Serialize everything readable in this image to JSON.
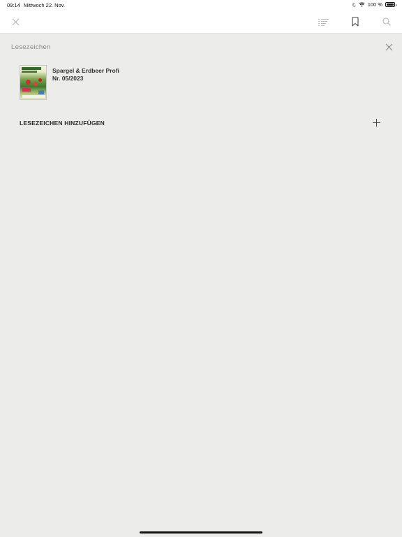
{
  "status_bar": {
    "time": "09:14",
    "date": "Mittwoch 22. Nov.",
    "battery_text": "100 %",
    "battery_level": 1.0
  },
  "toolbar": {
    "icons": [
      "close-icon",
      "list-icon",
      "bookmark-icon",
      "search-icon"
    ]
  },
  "panel": {
    "title": "Lesezeichen",
    "bookmarks": [
      {
        "title": "Spargel & Erdbeer Profi",
        "issue": "Nr. 05/2023"
      }
    ],
    "add_label": "LESEZEICHEN HINZUFÜGEN"
  },
  "colors": {
    "background": "#ececea",
    "toolbar": "#ffffff",
    "icon_muted": "#b5b5b5",
    "text_muted": "#8a8a8a"
  }
}
